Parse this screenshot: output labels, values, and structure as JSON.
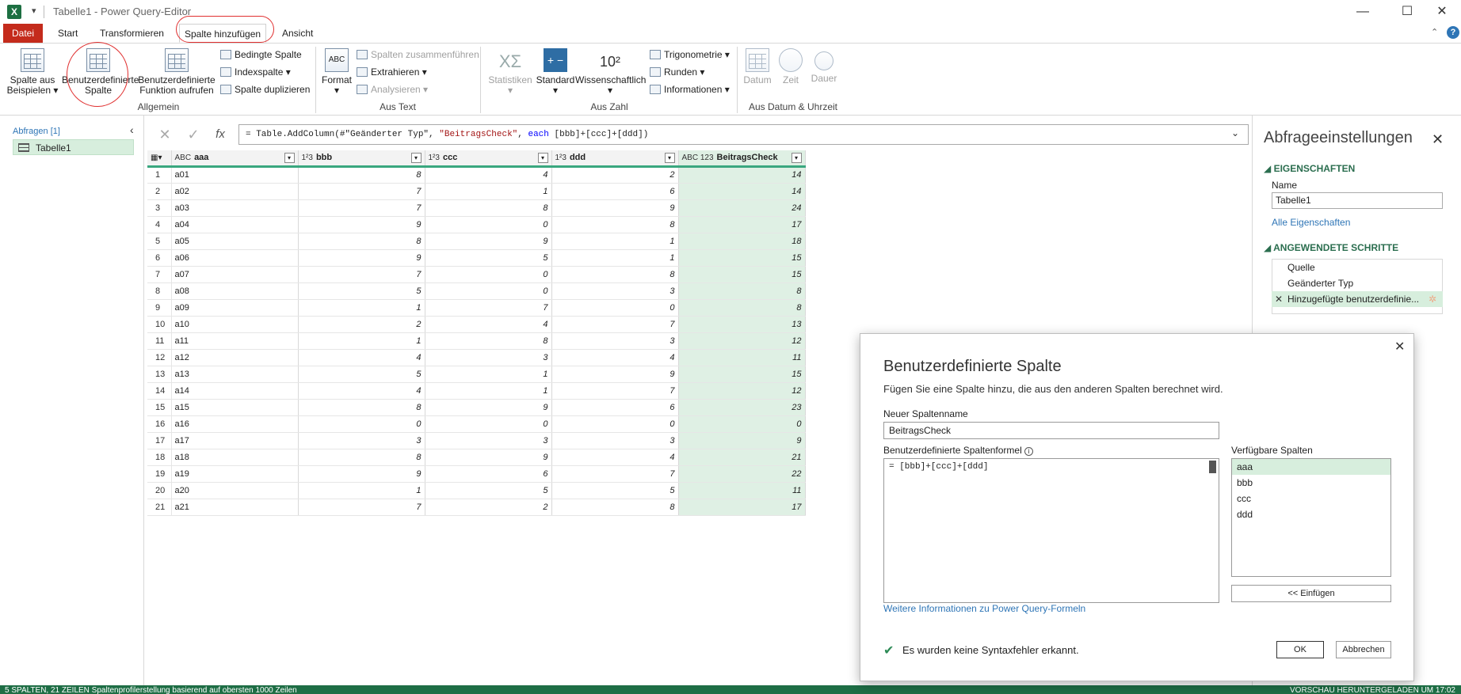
{
  "window": {
    "app_icon": "X",
    "title": "Tabelle1 - Power Query-Editor"
  },
  "tabs": [
    "Datei",
    "Start",
    "Transformieren",
    "Spalte hinzufügen",
    "Ansicht"
  ],
  "ribbon": {
    "example_col_1": "Spalte aus",
    "example_col_2": "Beispielen",
    "custom_col_1": "Benutzerdefinierte",
    "custom_col_2": "Spalte",
    "invoke_fn_1": "Benutzerdefinierte",
    "invoke_fn_2": "Funktion aufrufen",
    "conditional_col": "Bedingte Spalte",
    "index_col": "Indexspalte",
    "duplicate_col": "Spalte duplizieren",
    "group_general": "Allgemein",
    "format": "Format",
    "merge_cols": "Spalten zusammenführen",
    "extract": "Extrahieren",
    "parse": "Analysieren",
    "group_text": "Aus Text",
    "statistics": "Statistiken",
    "standard": "Standard",
    "scientific": "Wissenschaftlich",
    "trig": "Trigonometrie",
    "rounding": "Runden",
    "information": "Informationen",
    "group_number": "Aus Zahl",
    "date": "Datum",
    "time": "Zeit",
    "duration": "Dauer",
    "group_datetime": "Aus Datum & Uhrzeit",
    "abc_icon": "ABC",
    "sci_icon": "10²",
    "sigma_icon": "ΧΣ"
  },
  "queries": {
    "header": "Abfragen [1]",
    "items": [
      "Tabelle1"
    ]
  },
  "formula": {
    "prefix": "= Table.AddColumn(#\"Geänderter Typ\", ",
    "str": "\"BeitragsCheck\"",
    "mid": ", ",
    "kw": "each",
    "suffix": " [bbb]+[ccc]+[ddd])"
  },
  "table": {
    "columns": [
      {
        "type": "ABC",
        "name": "aaa"
      },
      {
        "type": "1²3",
        "name": "bbb"
      },
      {
        "type": "1²3",
        "name": "ccc"
      },
      {
        "type": "1²3",
        "name": "ddd"
      },
      {
        "type": "ABC 123",
        "name": "BeitragsCheck"
      }
    ],
    "rows": [
      [
        "a01",
        8,
        4,
        2,
        14
      ],
      [
        "a02",
        7,
        1,
        6,
        14
      ],
      [
        "a03",
        7,
        8,
        9,
        24
      ],
      [
        "a04",
        9,
        0,
        8,
        17
      ],
      [
        "a05",
        8,
        9,
        1,
        18
      ],
      [
        "a06",
        9,
        5,
        1,
        15
      ],
      [
        "a07",
        7,
        0,
        8,
        15
      ],
      [
        "a08",
        5,
        0,
        3,
        8
      ],
      [
        "a09",
        1,
        7,
        0,
        8
      ],
      [
        "a10",
        2,
        4,
        7,
        13
      ],
      [
        "a11",
        1,
        8,
        3,
        12
      ],
      [
        "a12",
        4,
        3,
        4,
        11
      ],
      [
        "a13",
        5,
        1,
        9,
        15
      ],
      [
        "a14",
        4,
        1,
        7,
        12
      ],
      [
        "a15",
        8,
        9,
        6,
        23
      ],
      [
        "a16",
        0,
        0,
        0,
        0
      ],
      [
        "a17",
        3,
        3,
        3,
        9
      ],
      [
        "a18",
        8,
        9,
        4,
        21
      ],
      [
        "a19",
        9,
        6,
        7,
        22
      ],
      [
        "a20",
        1,
        5,
        5,
        11
      ],
      [
        "a21",
        7,
        2,
        8,
        17
      ]
    ]
  },
  "settings": {
    "title": "Abfrageeinstellungen",
    "properties": "EIGENSCHAFTEN",
    "name_label": "Name",
    "name_value": "Tabelle1",
    "all_props": "Alle Eigenschaften",
    "steps_header": "ANGEWENDETE SCHRITTE",
    "steps": [
      "Quelle",
      "Geänderter Typ",
      "Hinzugefügte benutzerdefinie..."
    ]
  },
  "dialog": {
    "title": "Benutzerdefinierte Spalte",
    "description": "Fügen Sie eine Spalte hinzu, die aus den anderen Spalten berechnet wird.",
    "name_label": "Neuer Spaltenname",
    "name_value": "BeitragsCheck",
    "formula_label": "Benutzerdefinierte Spaltenformel",
    "formula_value": "= [bbb]+[ccc]+[ddd]",
    "available_label": "Verfügbare Spalten",
    "available": [
      "aaa",
      "bbb",
      "ccc",
      "ddd"
    ],
    "insert": "<< Einfügen",
    "more_info": "Weitere Informationen zu Power Query-Formeln",
    "status": "Es wurden keine Syntaxfehler erkannt.",
    "ok": "OK",
    "cancel": "Abbrechen"
  },
  "statusbar": {
    "left": "5 SPALTEN, 21 ZEILEN    Spaltenprofilerstellung basierend auf obersten 1000 Zeilen",
    "right": "VORSCHAU HERUNTERGELADEN UM 17:02"
  },
  "colors": {
    "accent": "#1e6e45",
    "file_tab": "#c42b1c",
    "highlight": "#dff0e4",
    "annotation": "#e03030"
  }
}
